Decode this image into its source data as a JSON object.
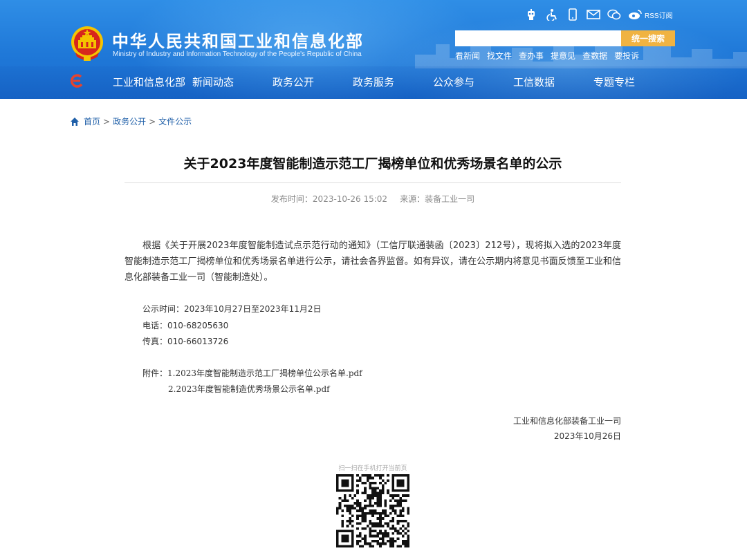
{
  "header": {
    "site_title": "中华人民共和国工业和信息化部",
    "site_subtitle": "Ministry of Industry and Information Technology of the People's Republic of China",
    "top_icons": [
      "robot-icon",
      "accessibility-icon",
      "mobile-icon",
      "mail-icon",
      "wechat-icon",
      "weibo-icon"
    ],
    "rss_label": "RSS订阅",
    "search": {
      "placeholder": "",
      "button_label": "统一搜索"
    },
    "quick_links": [
      "看新闻",
      "找文件",
      "查办事",
      "提意见",
      "查数据",
      "要投诉"
    ],
    "nav": [
      "工业和信息化部",
      "新闻动态",
      "政务公开",
      "政务服务",
      "公众参与",
      "工信数据",
      "专题专栏"
    ]
  },
  "breadcrumb": {
    "home": "首页",
    "level1": "政务公开",
    "level2": "文件公示",
    "separator": ">"
  },
  "article": {
    "title": "关于2023年度智能制造示范工厂揭榜单位和优秀场景名单的公示",
    "publish_time": "发布时间：2023-10-26 15:02",
    "source": "来源：装备工业一司",
    "body": "根据《关于开展2023年度智能制造试点示范行动的通知》（工信厅联通装函〔2023〕212号），现将拟入选的2023年度智能制造示范工厂揭榜单位和优秀场景名单进行公示，请社会各界监督。如有异议，请在公示期内将意见书面反馈至工业和信息化部装备工业一司（智能制造处）。",
    "notice_period": "公示时间：2023年10月27日至2023年11月2日",
    "phone": "电话：010-68205630",
    "fax": "传真：010-66013726",
    "attachments_label": "附件：",
    "attachments": [
      "1.2023年度智能制造示范工厂揭榜单位公示名单.pdf",
      "2.2023年度智能制造优秀场景公示名单.pdf"
    ],
    "signature_org": "工业和信息化部装备工业一司",
    "signature_date": "2023年10月26日"
  },
  "qr": {
    "caption": "扫一扫在手机打开当前页"
  },
  "colors": {
    "header_blue": "#1f78d8",
    "search_button": "#f0b342",
    "link_blue": "#1f5fa8",
    "emblem_red": "#d7261c",
    "emblem_gold": "#f5c400"
  }
}
